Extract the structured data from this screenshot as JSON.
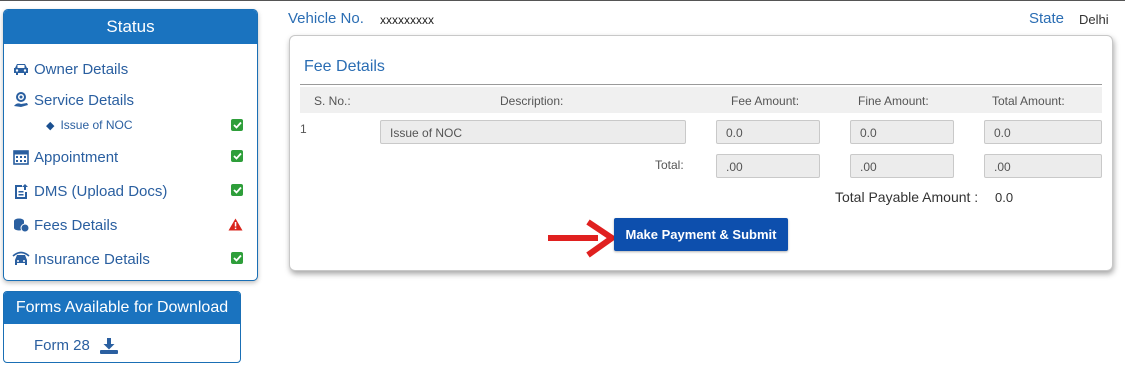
{
  "status_panel": {
    "title": "Status",
    "items": [
      {
        "label": "Owner Details",
        "icon": "car-icon",
        "state": "none"
      },
      {
        "label": "Service Details",
        "icon": "service-icon",
        "state": "none"
      },
      {
        "label": "Appointment",
        "icon": "calendar-icon",
        "state": "complete"
      },
      {
        "label": "DMS (Upload Docs)",
        "icon": "upload-doc-icon",
        "state": "complete"
      },
      {
        "label": "Fees Details",
        "icon": "coins-icon",
        "state": "warning"
      },
      {
        "label": "Insurance Details",
        "icon": "insurance-icon",
        "state": "complete"
      }
    ],
    "service_sub_items": [
      {
        "label": "Issue of NOC",
        "state": "complete"
      }
    ]
  },
  "forms_panel": {
    "title": "Forms Available for Download",
    "items": [
      {
        "label": "Form 28",
        "icon": "download-icon"
      }
    ]
  },
  "header": {
    "vehicle_label": "Vehicle No.",
    "vehicle_value": "xxxxxxxxx",
    "state_label": "State",
    "state_value": "Delhi"
  },
  "fee_details": {
    "title": "Fee Details",
    "columns": [
      "S. No.:",
      "Description:",
      "Fee Amount:",
      "Fine Amount:",
      "Total Amount:"
    ],
    "rows": [
      {
        "sno": "1",
        "description": "Issue of NOC",
        "fee": "0.0",
        "fine": "0.0",
        "total": "0.0"
      }
    ],
    "total_label": "Total:",
    "totals": {
      "fee": ".00",
      "fine": ".00",
      "total": ".00"
    },
    "payable_label": "Total Payable Amount :",
    "payable_value": "0.0",
    "submit_label": "Make Payment & Submit"
  },
  "colors": {
    "panel_header": "#1a73bf",
    "link_text": "#2a5fa0",
    "button": "#0d4fad",
    "check_green": "#2e9e3a",
    "warning_red": "#d9251d",
    "arrow_red": "#e0201f"
  }
}
